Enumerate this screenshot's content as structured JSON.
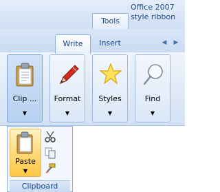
{
  "header": {
    "title": "Office 2007 style ribbon",
    "contextual_tab": "Tools"
  },
  "tabs": [
    {
      "label": "Write",
      "active": true
    },
    {
      "label": "Insert",
      "active": false
    }
  ],
  "ribbon_buttons": [
    {
      "label": "Clip ...",
      "icon": "clipboard-icon",
      "state": "pressed"
    },
    {
      "label": "Format",
      "icon": "pencil-icon"
    },
    {
      "label": "Styles",
      "icon": "star-icon"
    },
    {
      "label": "Find",
      "icon": "magnifier-icon"
    }
  ],
  "clipboard_popup": {
    "paste_label": "Paste",
    "small_icons": [
      "scissors-icon",
      "copy-icon",
      "format-painter-icon"
    ],
    "group_label": "Clipboard"
  },
  "colors": {
    "accent": "#15428b",
    "hover": "#ffd874"
  }
}
